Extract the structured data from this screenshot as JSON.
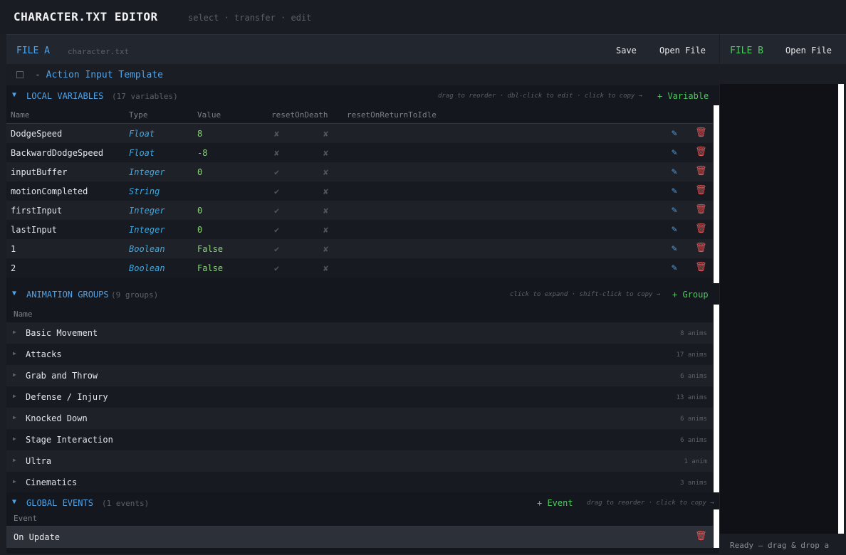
{
  "app": {
    "title": "CHARACTER.TXT EDITOR",
    "subtitle": "select · transfer · edit"
  },
  "fileA": {
    "label": "FILE A",
    "filename": "character.txt",
    "save_label": "Save",
    "open_label": "Open File",
    "template_title": "- Action Input Template"
  },
  "localVars": {
    "title": "LOCAL VARIABLES",
    "count": "(17 variables)",
    "hint": "drag to reorder  ·  dbl-click to edit  ·  click to copy →",
    "add_label": "+ Variable",
    "columns": [
      "Name",
      "Type",
      "Value",
      "resetOnDeath",
      "resetOnReturnToIdle"
    ],
    "rows": [
      {
        "name": "DodgeSpeed",
        "type": "Float",
        "value": "8",
        "c1": "✘",
        "c2": "✘"
      },
      {
        "name": "BackwardDodgeSpeed",
        "type": "Float",
        "value": "-8",
        "c1": "✘",
        "c2": "✘"
      },
      {
        "name": "inputBuffer",
        "type": "Integer",
        "value": "0",
        "c1": "✔",
        "c2": "✘"
      },
      {
        "name": "motionCompleted",
        "type": "String",
        "value": "",
        "c1": "✔",
        "c2": "✘"
      },
      {
        "name": "firstInput",
        "type": "Integer",
        "value": "0",
        "c1": "✔",
        "c2": "✘"
      },
      {
        "name": "lastInput",
        "type": "Integer",
        "value": "0",
        "c1": "✔",
        "c2": "✘"
      },
      {
        "name": "1",
        "type": "Boolean",
        "value": "False",
        "c1": "✔",
        "c2": "✘"
      },
      {
        "name": "2",
        "type": "Boolean",
        "value": "False",
        "c1": "✔",
        "c2": "✘"
      }
    ],
    "icons": {
      "edit": "pencil-icon",
      "delete": "trash-icon"
    }
  },
  "animGroups": {
    "title": "ANIMATION GROUPS",
    "count": "(9 groups)",
    "hint": "click to expand  ·  shift-click to copy →",
    "add_label": "+ Group",
    "column": "Name",
    "rows": [
      {
        "name": "Basic Movement",
        "count": "8 anims"
      },
      {
        "name": "Attacks",
        "count": "17 anims"
      },
      {
        "name": "Grab and Throw",
        "count": "6 anims"
      },
      {
        "name": "Defense / Injury",
        "count": "13 anims"
      },
      {
        "name": "Knocked Down",
        "count": "6 anims"
      },
      {
        "name": "Stage Interaction",
        "count": "6 anims"
      },
      {
        "name": "Ultra",
        "count": "1 anim"
      },
      {
        "name": "Cinematics",
        "count": "3 anims"
      }
    ]
  },
  "globalEvents": {
    "title": "GLOBAL EVENTS",
    "count": "(1 events)",
    "add_label": "+ Event",
    "hint": "drag to reorder  ·  click to copy →",
    "column": "Event",
    "rows": [
      {
        "name": "On Update"
      }
    ]
  },
  "fileB": {
    "label": "FILE B",
    "open_label": "Open File",
    "status": "Ready  —  drag & drop a"
  },
  "colors": {
    "accent_blue": "#4fa3e8",
    "accent_green": "#4ec95f",
    "value_green": "#8cd37a",
    "type_blue": "#3fa8e0",
    "delete_red": "#e05656",
    "background": "#15171e"
  }
}
